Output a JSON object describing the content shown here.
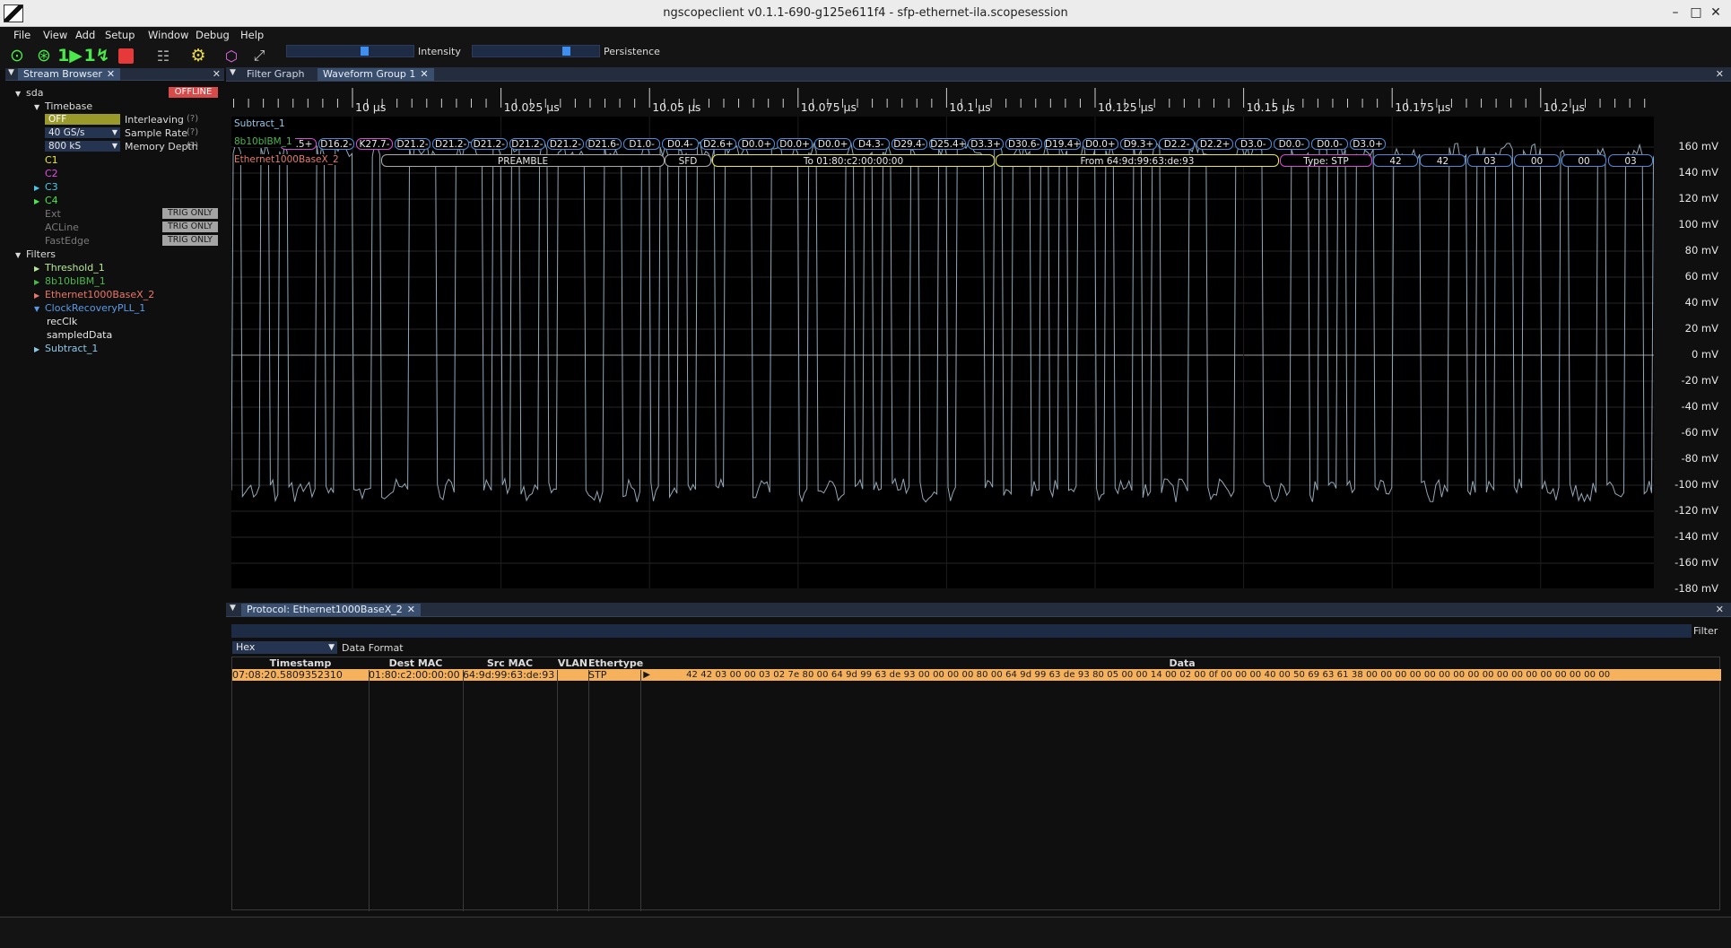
{
  "window": {
    "title": "ngscopeclient v0.1.1-690-g125e611f4 - sfp-ethernet-ila.scopesession"
  },
  "menu": [
    "File",
    "View",
    "Add",
    "Setup",
    "Window",
    "Debug",
    "Help"
  ],
  "toolbar": {
    "intensity_label": "Intensity",
    "persistence_label": "Persistence",
    "intensity_value": 0.62,
    "persistence_value": 0.75
  },
  "stream_browser": {
    "tab": "Stream Browser",
    "instrument": "sda",
    "status": "OFFLINE",
    "timebase_label": "Timebase",
    "interleaving": {
      "value": "OFF",
      "label": "Interleaving",
      "help": "(?)"
    },
    "sample_rate": {
      "value": "40 GS/s",
      "label": "Sample Rate",
      "help": "(?)"
    },
    "memory_depth": {
      "value": "800 kS",
      "label": "Memory Depth",
      "help": "(?)"
    },
    "channels": [
      {
        "name": "C1",
        "color": "#e8e84a"
      },
      {
        "name": "C2",
        "color": "#e84ae8"
      },
      {
        "name": "C3",
        "color": "#4ac8e8"
      },
      {
        "name": "C4",
        "color": "#4ae84a"
      }
    ],
    "trig_inputs": [
      {
        "name": "Ext",
        "badge": "TRIG ONLY"
      },
      {
        "name": "ACLine",
        "badge": "TRIG ONLY"
      },
      {
        "name": "FastEdge",
        "badge": "TRIG ONLY"
      }
    ],
    "filters_label": "Filters",
    "filters": [
      {
        "name": "Threshold_1",
        "color": "#b7e89a"
      },
      {
        "name": "8b10bIBM_1",
        "color": "#4ab84a"
      },
      {
        "name": "Ethernet1000BaseX_2",
        "color": "#e8786a"
      },
      {
        "name": "ClockRecoveryPLL_1",
        "color": "#5a9ae8"
      }
    ],
    "pll_outputs": [
      "recClk",
      "sampledData"
    ],
    "last_filter": {
      "name": "Subtract_1",
      "color": "#8ec8e8"
    }
  },
  "waveform": {
    "tabs": [
      "Filter Graph",
      "Waveform Group 1"
    ],
    "time_labels": [
      "10 µs",
      "10.025 µs",
      "10.05 µs",
      "10.075 µs",
      "10.1 µs",
      "10.125 µs",
      "10.15 µs",
      "10.175 µs",
      "10.2 µs"
    ],
    "trace_name": "Subtract_1",
    "decode_8b10b_label": "8b10bIBM_1",
    "decode_eth_label": "Ethernet1000BaseX_2",
    "symbols": [
      "28.5+",
      "D16.2-",
      "K27.7-",
      "D21.2-",
      "D21.2-",
      "D21.2-",
      "D21.2-",
      "D21.2-",
      "D21.6-",
      "D1.0-",
      "D0.4-",
      "D2.6+",
      "D0.0+",
      "D0.0+",
      "D0.0+",
      "D4.3-",
      "D29.4-",
      "D25.4+",
      "D3.3+",
      "D30.6-",
      "D19.4+",
      "D0.0+",
      "D9.3+",
      "D2.2-",
      "D2.2+",
      "D3.0-",
      "D0.0-",
      "D0.0-",
      "D3.0+"
    ],
    "eth_fields": [
      {
        "text": "PREAMBLE"
      },
      {
        "text": "SFD"
      },
      {
        "text": "To 01:80:c2:00:00:00"
      },
      {
        "text": "From 64:9d:99:63:de:93"
      },
      {
        "text": "Type: STP"
      },
      {
        "text": "42"
      },
      {
        "text": "42"
      },
      {
        "text": "03"
      },
      {
        "text": "00"
      },
      {
        "text": "00"
      },
      {
        "text": "03"
      }
    ],
    "y_labels": [
      "160 mV",
      "140 mV",
      "120 mV",
      "100 mV",
      "80 mV",
      "60 mV",
      "40 mV",
      "20 mV",
      "0 mV",
      "-20 mV",
      "-40 mV",
      "-60 mV",
      "-80 mV",
      "-100 mV",
      "-120 mV",
      "-140 mV",
      "-160 mV",
      "-180 mV"
    ]
  },
  "protocol": {
    "tab": "Protocol: Ethernet1000BaseX_2",
    "filter_label": "Filter",
    "format_value": "Hex",
    "format_label": "Data Format",
    "columns": [
      "Timestamp",
      "Dest MAC",
      "Src MAC",
      "VLAN",
      "Ethertype",
      "Data"
    ],
    "rows": [
      {
        "timestamp": "07:08:20.5809352310",
        "dest": "01:80:c2:00:00:00",
        "src": "64:9d:99:63:de:93",
        "vlan": "",
        "ethertype": "STP",
        "data": "42 42 03 00 00 03 02 7e 80 00 64 9d 99 63 de 93 00 00 00 00 80 00 64 9d 99 63 de 93 80 05 00 00 14 00 02 00 0f 00 00 00 40 00 50 69 63 61 38 00 00 00 00 00 00 00 00 00 00 00 00 00 00 00 00 00"
      }
    ]
  }
}
